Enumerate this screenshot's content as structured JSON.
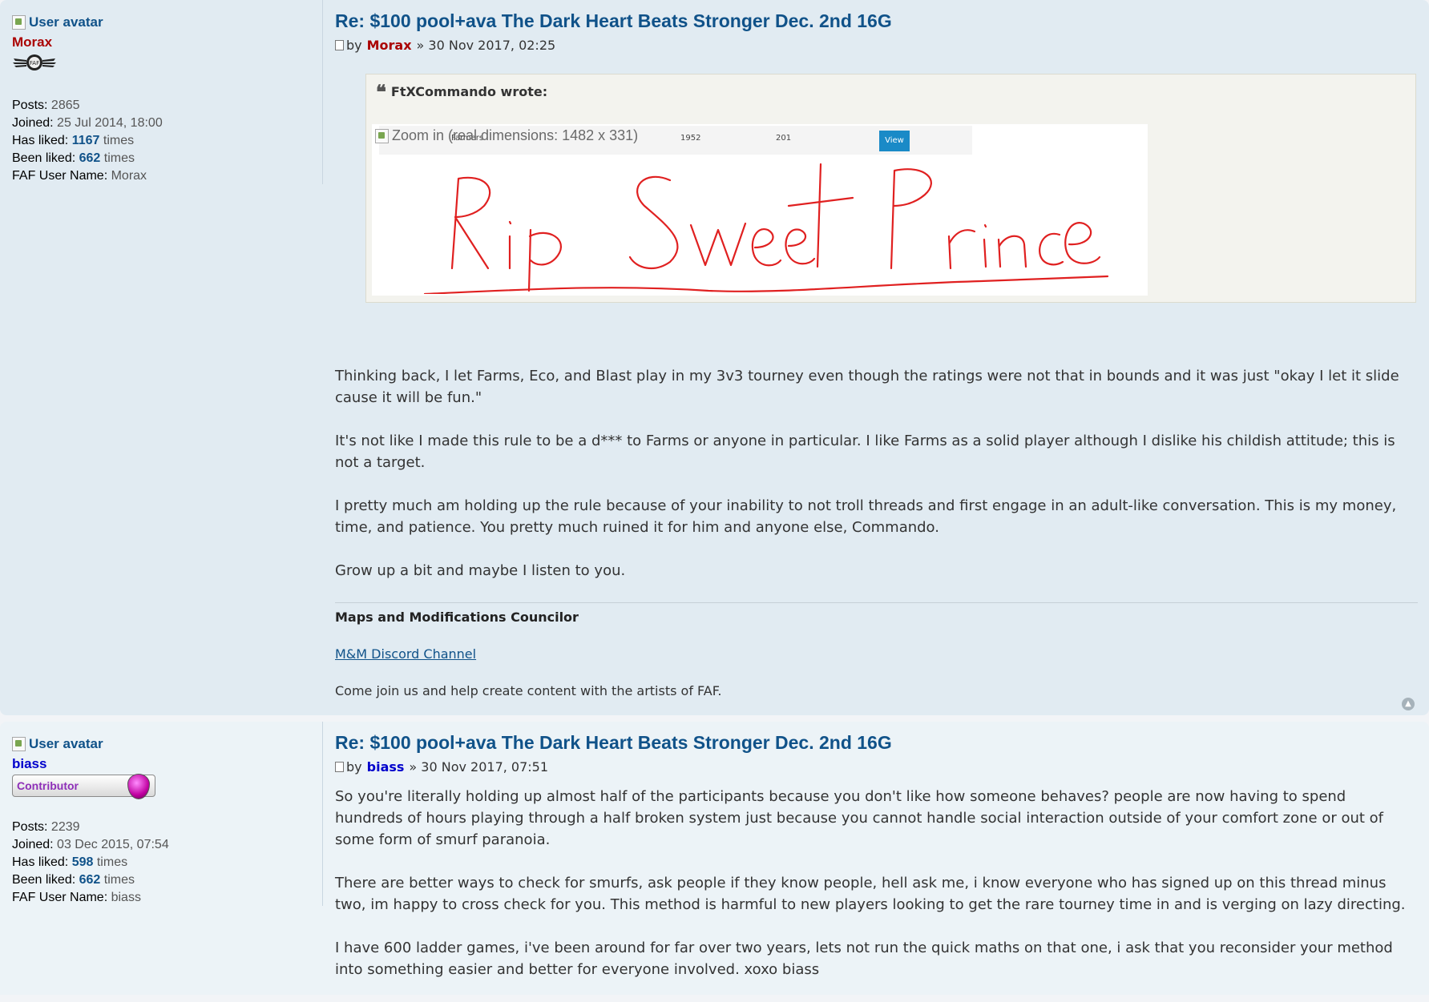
{
  "posts": [
    {
      "avatar_alt": "User avatar",
      "username": "Morax",
      "rank_label": "",
      "stats": {
        "posts_label": "Posts:",
        "posts": "2865",
        "joined_label": "Joined:",
        "joined": "25 Jul 2014, 18:00",
        "has_liked_label": "Has liked:",
        "has_liked": "1167",
        "times": "times",
        "been_liked_label": "Been liked:",
        "been_liked": "662",
        "faf_label": "FAF User Name:",
        "faf_name": "Morax"
      },
      "title": "Re: $100 pool+ava The Dark Heart Beats Stronger Dec. 2nd 16G",
      "by": "by",
      "author": "Morax",
      "date": "» 30 Nov 2017, 02:25",
      "quote": {
        "cite": "FtXCommando wrote:",
        "image_alt": "Zoom in (real dimensions: 1482 x 331)",
        "strip_n0": "Farmers",
        "strip_n1": "1952",
        "strip_n2": "201",
        "view_label": "View",
        "handwriting": "Rip Sweet Prince"
      },
      "paragraphs": [
        "Thinking back, I let Farms, Eco, and Blast play in my 3v3 tourney even though the ratings were not that in bounds and it was just \"okay I let it slide cause it will be fun.\"",
        "It's not like I made this rule to be a d*** to Farms or anyone in particular. I like Farms as a solid player although I dislike his childish attitude; this is not a target.",
        "I pretty much am holding up the rule because of your inability to not troll threads and first engage in an adult-like conversation. This is my money, time, and patience. You pretty much ruined it for him and anyone else, Commando.",
        "Grow up a bit and maybe I listen to you."
      ],
      "signature": {
        "heading": "Maps and Modifications Councilor",
        "link": "M&M Discord Channel",
        "text": "Come join us and help create content with the artists of FAF."
      }
    },
    {
      "avatar_alt": "User avatar",
      "username": "biass",
      "rank_label": "Contributor",
      "stats": {
        "posts_label": "Posts:",
        "posts": "2239",
        "joined_label": "Joined:",
        "joined": "03 Dec 2015, 07:54",
        "has_liked_label": "Has liked:",
        "has_liked": "598",
        "times": "times",
        "been_liked_label": "Been liked:",
        "been_liked": "662",
        "faf_label": "FAF User Name:",
        "faf_name": "biass"
      },
      "title": "Re: $100 pool+ava The Dark Heart Beats Stronger Dec. 2nd 16G",
      "by": "by",
      "author": "biass",
      "date": "» 30 Nov 2017, 07:51",
      "paragraphs": [
        "So you're literally holding up almost half of the participants because you don't like how someone behaves? people are now having to spend hundreds of hours playing through a half broken system just because you cannot handle social interaction outside of your comfort zone or out of some form of smurf paranoia.",
        "There are better ways to check for smurfs, ask people if they know people, hell ask me, i know everyone who has signed up on this thread minus two, im happy to cross check for you. This method is harmful to new players looking to get the rare tourney time in and is verging on lazy directing.",
        "I have 600 ladder games, i've been around for far over two years, lets not run the quick maths on that one, i ask that you reconsider your method into something easier and better for everyone involved. xoxo biass"
      ]
    }
  ],
  "colors": {
    "post_bg_1": "#e1ebf2",
    "post_bg_2": "#ecf3f7",
    "link_blue": "#105289",
    "author_red": "#aa0000",
    "author_blue": "#0000cc",
    "handwriting_red": "#e02020"
  },
  "icons": {
    "post_icon": "document-icon",
    "quote_icon": "quote-mark-icon",
    "top_icon": "back-to-top-icon",
    "rank_icon_1": "faf-wings-badge-icon",
    "rank_icon_2": "contributor-gem-icon"
  }
}
